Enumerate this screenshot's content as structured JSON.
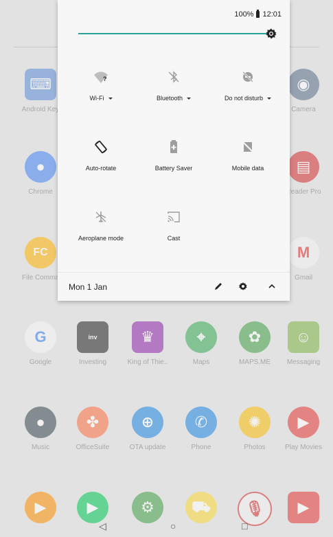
{
  "status": {
    "battery": "100%",
    "time": "12:01"
  },
  "tiles": [
    {
      "label": "Wi-Fi",
      "icon": "wifi-icon",
      "dropdown": true
    },
    {
      "label": "Bluetooth",
      "icon": "bluetooth-off-icon",
      "dropdown": true
    },
    {
      "label": "Do not disturb",
      "icon": "do-not-disturb-icon",
      "dropdown": true
    },
    {
      "label": "Auto-rotate",
      "icon": "auto-rotate-icon",
      "dropdown": false
    },
    {
      "label": "Battery Saver",
      "icon": "battery-saver-icon",
      "dropdown": false
    },
    {
      "label": "Mobile data",
      "icon": "mobile-data-off-icon",
      "dropdown": false
    },
    {
      "label": "Aeroplane mode",
      "icon": "airplane-mode-icon",
      "dropdown": false
    },
    {
      "label": "Cast",
      "icon": "cast-icon",
      "dropdown": false
    }
  ],
  "footer": {
    "date": "Mon 1 Jan"
  },
  "home_apps": [
    {
      "label": "Android Key",
      "color": "#5a8bd6"
    },
    {
      "label": "Camera",
      "color": "#5b6f8a"
    },
    {
      "label": "Chrome",
      "color": "#4285f4"
    },
    {
      "label": "Reader Pro",
      "color": "#d32f2f"
    },
    {
      "label": "File Comma",
      "color": "#ffb300"
    },
    {
      "label": "Gmail",
      "color": "#e53935"
    },
    {
      "label": "Google",
      "color": "#4285f4"
    },
    {
      "label": "Investing",
      "color": "#222222"
    },
    {
      "label": "King of Thie..",
      "color": "#8e24aa"
    },
    {
      "label": "Maps",
      "color": "#34a853"
    },
    {
      "label": "MAPS.ME",
      "color": "#43a047"
    },
    {
      "label": "Messaging",
      "color": "#7cb342"
    },
    {
      "label": "Music",
      "color": "#37474f"
    },
    {
      "label": "OfficeSuite",
      "color": "#ff7043"
    },
    {
      "label": "OTA update",
      "color": "#1e88e5"
    },
    {
      "label": "Phone",
      "color": "#1e88e5"
    },
    {
      "label": "Photos",
      "color": "#fbbc05"
    },
    {
      "label": "Play Movies",
      "color": "#e53935"
    }
  ]
}
